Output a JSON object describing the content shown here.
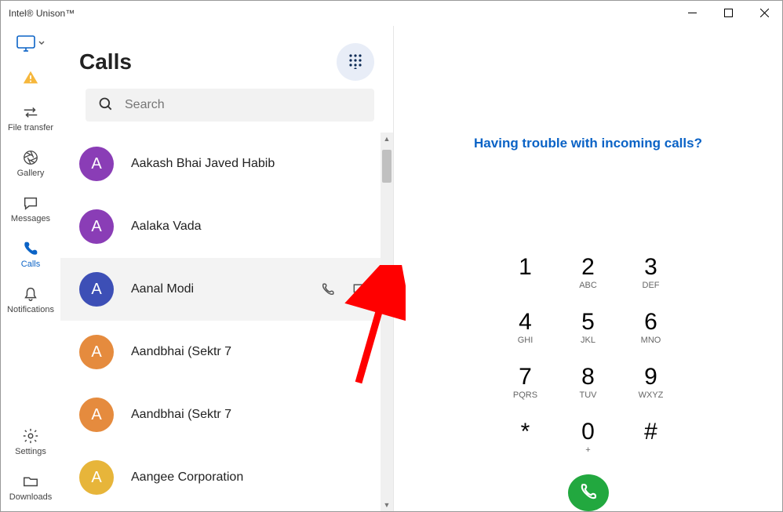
{
  "window": {
    "title": "Intel® Unison™"
  },
  "sidebar": {
    "file_transfer": "File transfer",
    "gallery": "Gallery",
    "messages": "Messages",
    "calls": "Calls",
    "notifications": "Notifications",
    "settings": "Settings",
    "downloads": "Downloads"
  },
  "calls": {
    "heading": "Calls",
    "search_placeholder": "Search",
    "contacts": [
      {
        "initial": "A",
        "name": "Aakash Bhai Javed Habib",
        "color": "purple"
      },
      {
        "initial": "A",
        "name": "Aalaka Vada",
        "color": "purple"
      },
      {
        "initial": "A",
        "name": "Aanal Modi",
        "color": "blue",
        "hovered": true
      },
      {
        "initial": "A",
        "name": "Aandbhai (Sektr 7",
        "color": "orange"
      },
      {
        "initial": "A",
        "name": "Aandbhai (Sektr 7",
        "color": "orange"
      },
      {
        "initial": "A",
        "name": "Aangee Corporation",
        "color": "yellow"
      }
    ]
  },
  "right": {
    "help_text": "Having trouble with incoming calls?",
    "keys": [
      {
        "d": "1",
        "l": ""
      },
      {
        "d": "2",
        "l": "ABC"
      },
      {
        "d": "3",
        "l": "DEF"
      },
      {
        "d": "4",
        "l": "GHI"
      },
      {
        "d": "5",
        "l": "JKL"
      },
      {
        "d": "6",
        "l": "MNO"
      },
      {
        "d": "7",
        "l": "PQRS"
      },
      {
        "d": "8",
        "l": "TUV"
      },
      {
        "d": "9",
        "l": "WXYZ"
      },
      {
        "d": "*",
        "l": ""
      },
      {
        "d": "0",
        "l": "+"
      },
      {
        "d": "#",
        "l": ""
      }
    ]
  }
}
